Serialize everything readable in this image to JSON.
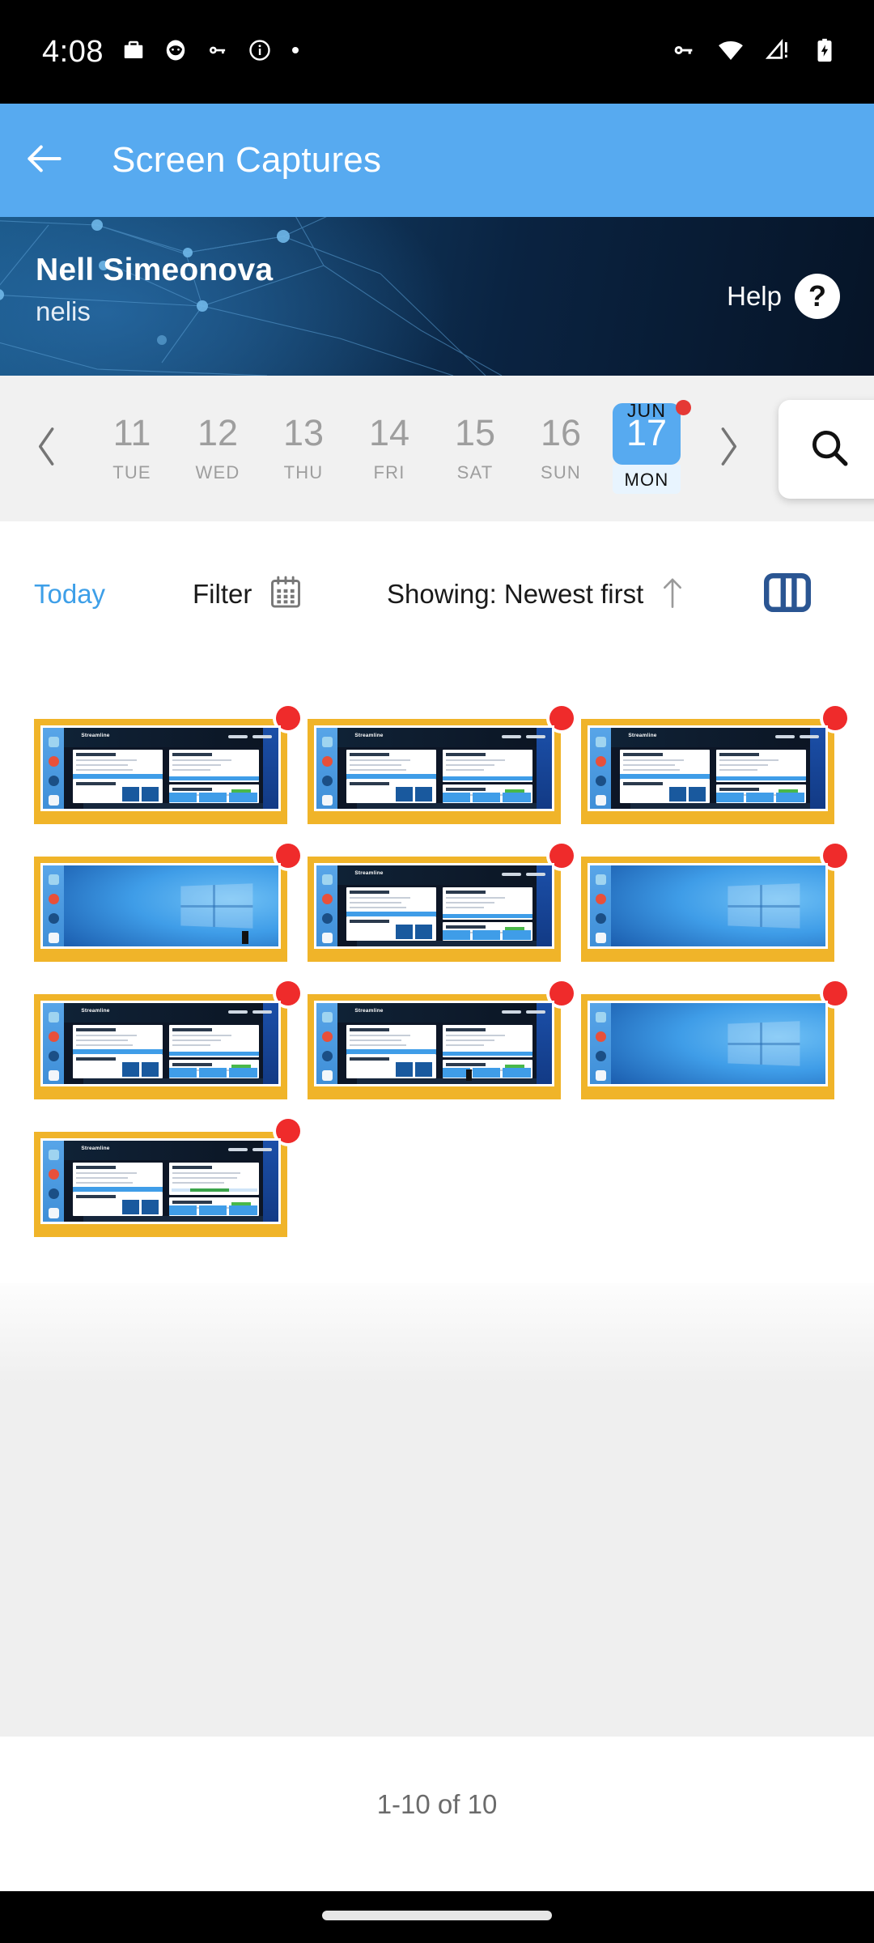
{
  "status_bar": {
    "time": "4:08",
    "left_icons": [
      "briefcase-icon",
      "face-icon",
      "key-icon",
      "info-icon",
      "dot-icon"
    ],
    "right_icons": [
      "vpn-key-icon",
      "wifi-icon",
      "cellular-no-signal-icon",
      "battery-charging-icon"
    ]
  },
  "app_bar": {
    "back_icon": "arrow-back-icon",
    "title": "Screen Captures",
    "background": "#57AAF0"
  },
  "banner": {
    "name": "Nell Simeonova",
    "username": "nelis",
    "help_label": "Help",
    "help_icon": "question-mark-icon"
  },
  "date_strip": {
    "prev_icon": "chevron-left-icon",
    "next_icon": "chevron-right-icon",
    "month_label": "JUN",
    "has_notification_dot": true,
    "notification_color": "#e53935",
    "selected_color": "#57AAF0",
    "days": [
      {
        "num": "11",
        "dow": "TUE",
        "selected": false
      },
      {
        "num": "12",
        "dow": "WED",
        "selected": false
      },
      {
        "num": "13",
        "dow": "THU",
        "selected": false
      },
      {
        "num": "14",
        "dow": "FRI",
        "selected": false
      },
      {
        "num": "15",
        "dow": "SAT",
        "selected": false
      },
      {
        "num": "16",
        "dow": "SUN",
        "selected": false
      },
      {
        "num": "17",
        "dow": "MON",
        "selected": true
      }
    ],
    "search_icon": "search-icon"
  },
  "toolbar": {
    "today_label": "Today",
    "today_color": "#3d9fe8",
    "filter_label": "Filter",
    "filter_icon": "calendar-icon",
    "showing_label": "Showing: Newest first",
    "sort_icon": "arrow-up-icon",
    "view_icon": "column-view-icon",
    "view_icon_color": "#2a5592"
  },
  "gallery": {
    "frame_color": "#f0b429",
    "badge_color": "#ef2b2b",
    "items": [
      {
        "kind": "app",
        "label": "screenshot-1",
        "unread": true
      },
      {
        "kind": "app",
        "label": "screenshot-2",
        "unread": true
      },
      {
        "kind": "app",
        "label": "screenshot-3",
        "unread": true
      },
      {
        "kind": "desk",
        "label": "screenshot-4",
        "unread": true
      },
      {
        "kind": "app",
        "label": "screenshot-5",
        "unread": true
      },
      {
        "kind": "desk",
        "label": "screenshot-6",
        "unread": true
      },
      {
        "kind": "app",
        "label": "screenshot-7",
        "unread": true
      },
      {
        "kind": "app",
        "label": "screenshot-8",
        "unread": true
      },
      {
        "kind": "desk",
        "label": "screenshot-9",
        "unread": true
      },
      {
        "kind": "app",
        "label": "screenshot-10",
        "unread": true
      }
    ]
  },
  "footer": {
    "pagination": "1-10 of 10"
  },
  "nav_bar": {
    "home_indicator": "home-indicator"
  }
}
